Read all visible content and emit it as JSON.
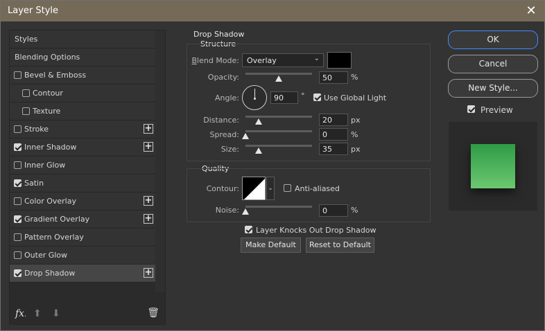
{
  "window": {
    "title": "Layer Style"
  },
  "styles_list": [
    {
      "label": "Styles",
      "checkbox": false,
      "checked": false,
      "indent": false,
      "plus": false,
      "selected": false
    },
    {
      "label": "Blending Options",
      "checkbox": false,
      "checked": false,
      "indent": false,
      "plus": false,
      "selected": false
    },
    {
      "label": "Bevel & Emboss",
      "checkbox": true,
      "checked": false,
      "indent": false,
      "plus": false,
      "selected": false
    },
    {
      "label": "Contour",
      "checkbox": true,
      "checked": false,
      "indent": true,
      "plus": false,
      "selected": false
    },
    {
      "label": "Texture",
      "checkbox": true,
      "checked": false,
      "indent": true,
      "plus": false,
      "selected": false
    },
    {
      "label": "Stroke",
      "checkbox": true,
      "checked": false,
      "indent": false,
      "plus": true,
      "selected": false
    },
    {
      "label": "Inner Shadow",
      "checkbox": true,
      "checked": true,
      "indent": false,
      "plus": true,
      "selected": false
    },
    {
      "label": "Inner Glow",
      "checkbox": true,
      "checked": false,
      "indent": false,
      "plus": false,
      "selected": false
    },
    {
      "label": "Satin",
      "checkbox": true,
      "checked": true,
      "indent": false,
      "plus": false,
      "selected": false
    },
    {
      "label": "Color Overlay",
      "checkbox": true,
      "checked": false,
      "indent": false,
      "plus": true,
      "selected": false
    },
    {
      "label": "Gradient Overlay",
      "checkbox": true,
      "checked": true,
      "indent": false,
      "plus": true,
      "selected": false
    },
    {
      "label": "Pattern Overlay",
      "checkbox": true,
      "checked": false,
      "indent": false,
      "plus": false,
      "selected": false
    },
    {
      "label": "Outer Glow",
      "checkbox": true,
      "checked": false,
      "indent": false,
      "plus": false,
      "selected": false
    },
    {
      "label": "Drop Shadow",
      "checkbox": true,
      "checked": true,
      "indent": false,
      "plus": true,
      "selected": true
    }
  ],
  "footer": {
    "fx_label": "fx"
  },
  "drop_shadow": {
    "section_title": "Drop Shadow",
    "structure_title": "Structure",
    "blend_mode": {
      "label": "Blend Mode:",
      "value": "Overlay",
      "color": "#000000"
    },
    "opacity": {
      "label": "Opacity:",
      "value": "50",
      "unit": "%",
      "level": 0.5
    },
    "angle": {
      "label": "Angle:",
      "value": "90",
      "unit": "°",
      "use_global_light": "Use Global Light",
      "global_checked": true
    },
    "distance": {
      "label": "Distance:",
      "value": "20",
      "unit": "px",
      "level": 0.2
    },
    "spread": {
      "label": "Spread:",
      "value": "0",
      "unit": "%",
      "level": 0.0
    },
    "size": {
      "label": "Size:",
      "value": "35",
      "unit": "px",
      "level": 0.2
    },
    "quality_title": "Quality",
    "contour": {
      "label": "Contour:",
      "anti_aliased": "Anti-aliased",
      "anti_aliased_checked": false
    },
    "noise": {
      "label": "Noise:",
      "value": "0",
      "unit": "%",
      "level": 0.0
    },
    "knockout": {
      "label": "Layer Knocks Out Drop Shadow",
      "checked": true
    },
    "make_default": "Make Default",
    "reset_default": "Reset to Default"
  },
  "right": {
    "ok": "OK",
    "cancel": "Cancel",
    "new_style": "New Style...",
    "preview": "Preview",
    "preview_checked": true
  },
  "colors": {
    "accent": "#3f8cff",
    "preview_top": "#2f9b46",
    "preview_bottom": "#6cc870"
  }
}
